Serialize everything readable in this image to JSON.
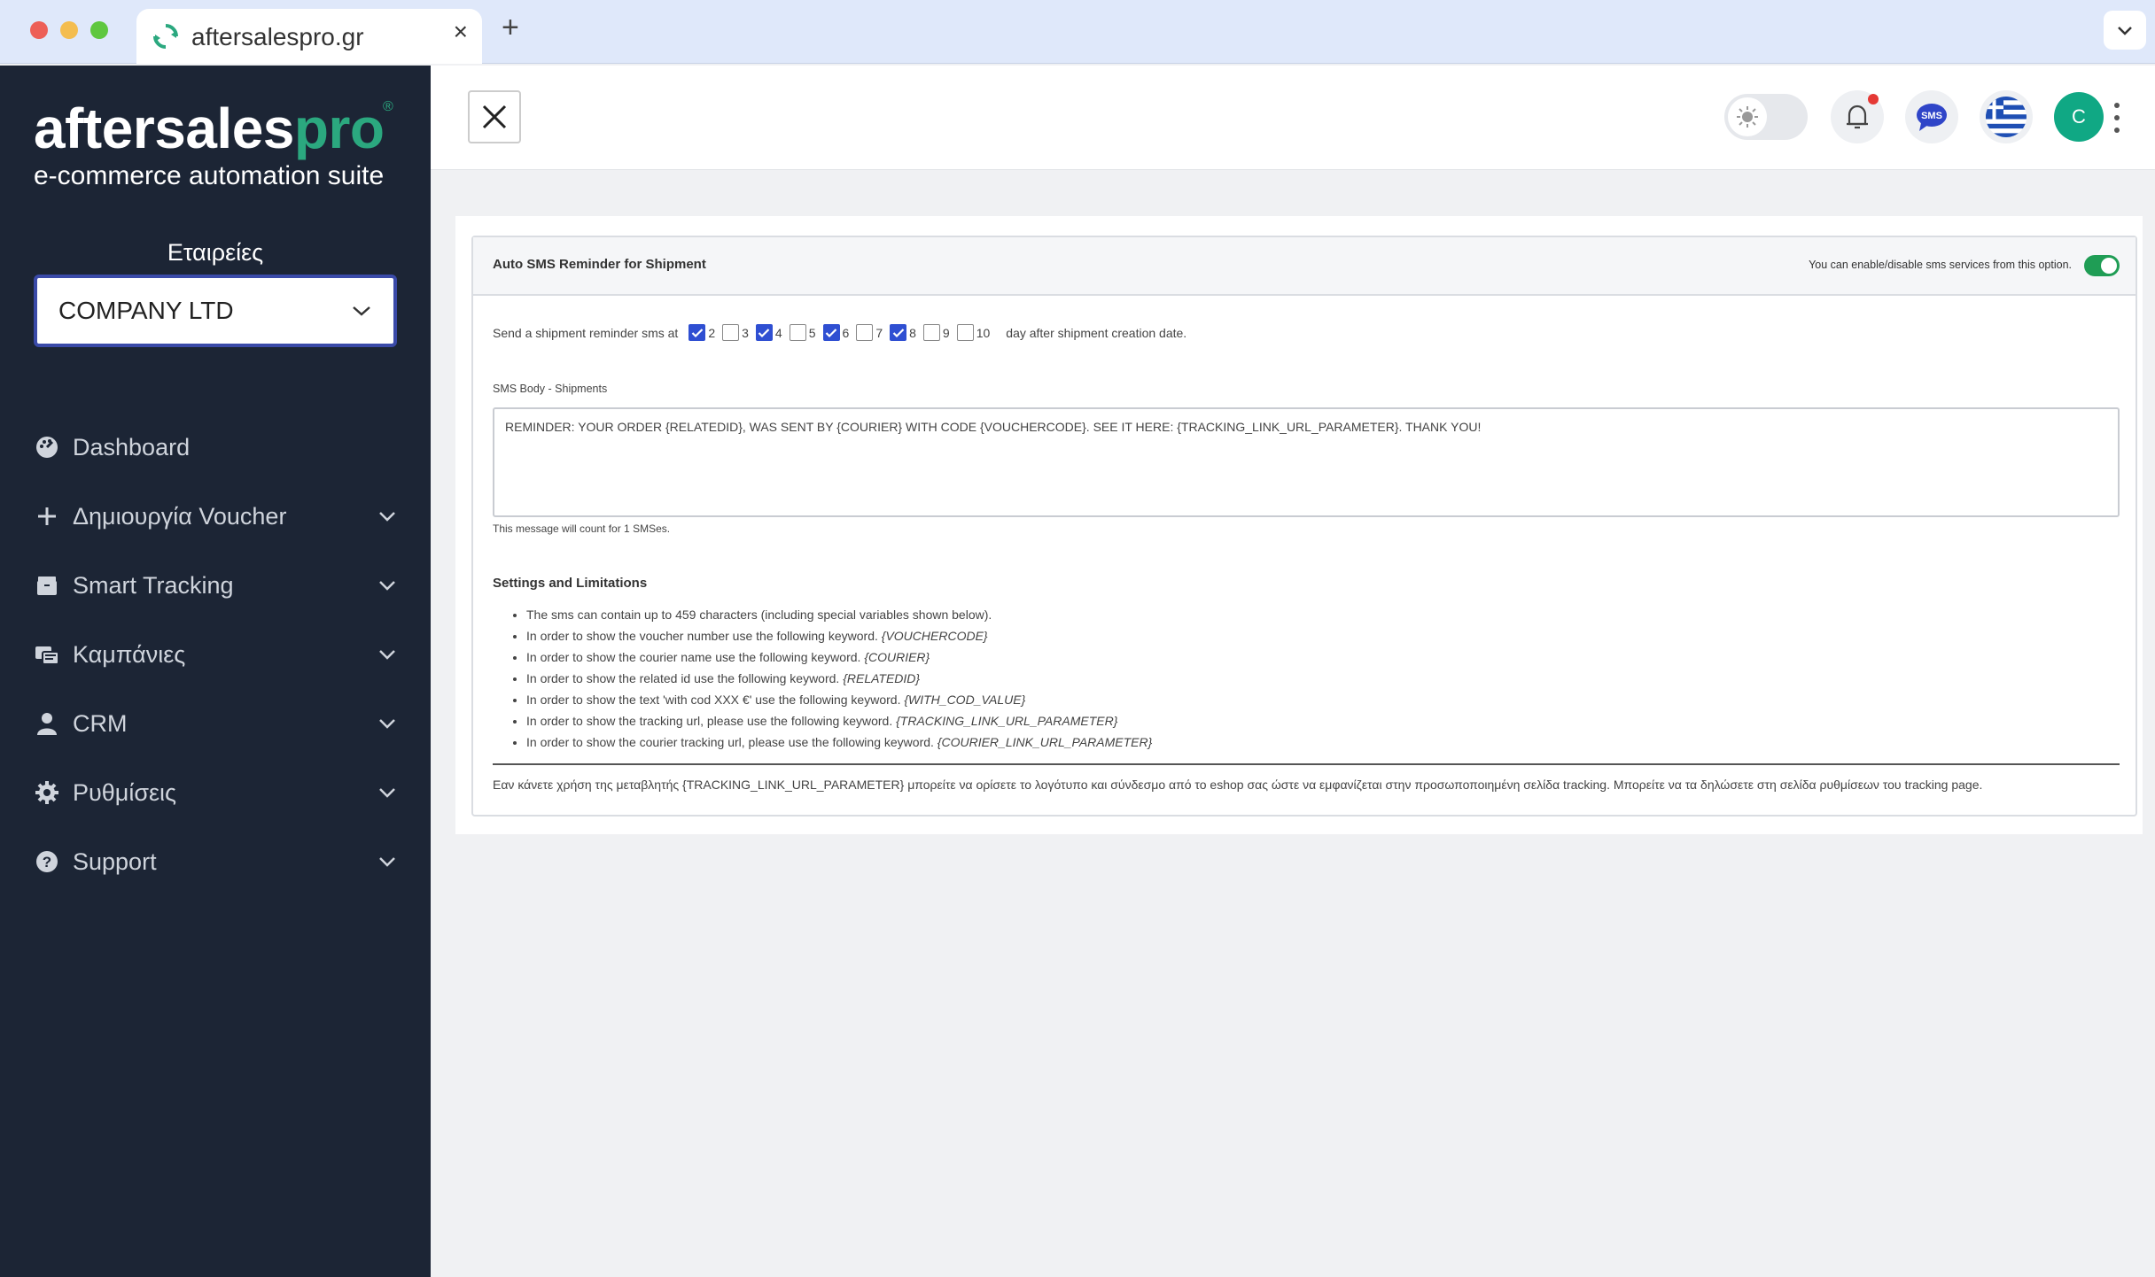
{
  "browser": {
    "tab_title": "aftersalespro.gr",
    "tab_close": "×",
    "new_tab": "+"
  },
  "sidebar": {
    "logo_main_a": "aftersales",
    "logo_main_b": "pro",
    "logo_reg": "®",
    "logo_sub": "e-commerce automation suite",
    "company_label": "Εταιρείες",
    "company_value": "COMPANY LTD",
    "items": [
      {
        "label": "Dashboard",
        "icon": "dashboard-icon"
      },
      {
        "label": "Δημιουργία Voucher",
        "icon": "plus-icon"
      },
      {
        "label": "Smart Tracking",
        "icon": "box-icon"
      },
      {
        "label": "Καμπάνιες",
        "icon": "campaign-icon"
      },
      {
        "label": "CRM",
        "icon": "user-icon"
      },
      {
        "label": "Ρυθμίσεις",
        "icon": "gear-icon"
      },
      {
        "label": "Support",
        "icon": "help-icon"
      }
    ]
  },
  "header": {
    "avatar_letter": "C",
    "sms_badge": "SMS"
  },
  "card": {
    "title": "Auto SMS Reminder for Shipment",
    "enable_text": "You can enable/disable sms services from this option.",
    "reminder_lead": "Send a shipment reminder sms at",
    "reminder_tail": "day after shipment creation date.",
    "days": [
      {
        "label": "2",
        "checked": true
      },
      {
        "label": "3",
        "checked": false
      },
      {
        "label": "4",
        "checked": true
      },
      {
        "label": "5",
        "checked": false
      },
      {
        "label": "6",
        "checked": true
      },
      {
        "label": "7",
        "checked": false
      },
      {
        "label": "8",
        "checked": true
      },
      {
        "label": "9",
        "checked": false
      },
      {
        "label": "10",
        "checked": false
      }
    ],
    "body_label": "SMS Body - Shipments",
    "body_value": "REMINDER: YOUR ORDER {RELATEDID}, WAS SENT BY {COURIER} WITH CODE {VOUCHERCODE}. SEE IT HERE: {TRACKING_LINK_URL_PARAMETER}. THANK YOU!",
    "count_note": "This message will count for 1 SMSes.",
    "settings_title": "Settings and Limitations",
    "settings": [
      {
        "text": "The sms can contain up to 459 characters (including special variables shown below).",
        "kw": ""
      },
      {
        "text": "In order to show the voucher number use the following keyword. ",
        "kw": "{VOUCHERCODE}"
      },
      {
        "text": "In order to show the courier name use the following keyword. ",
        "kw": "{COURIER}"
      },
      {
        "text": "In order to show the related id use the following keyword. ",
        "kw": "{RELATEDID}"
      },
      {
        "text": "In order to show the text 'with cod XXX €' use the following keyword. ",
        "kw": "{WITH_COD_VALUE}"
      },
      {
        "text": "In order to show the tracking url, please use the following keyword. ",
        "kw": "{TRACKING_LINK_URL_PARAMETER}"
      },
      {
        "text": "In order to show the courier tracking url, please use the following keyword. ",
        "kw": "{COURIER_LINK_URL_PARAMETER}"
      }
    ],
    "footer_note": "Εαν κάνετε χρήση της μεταβλητής {TRACKING_LINK_URL_PARAMETER} μπορείτε να ορίσετε το λογότυπο και σύνδεσμο από το eshop σας ώστε να εμφανίζεται στην προσωποποιημένη σελίδα tracking. Μπορείτε να τα δηλώσετε στη σελίδα ρυθμίσεων του tracking page."
  },
  "colors": {
    "sidebar_bg": "#1c2535",
    "accent_green": "#2ba87f",
    "checkbox_blue": "#2f4fd2",
    "toggle_green": "#1f9d55",
    "avatar_bg": "#10a884"
  }
}
